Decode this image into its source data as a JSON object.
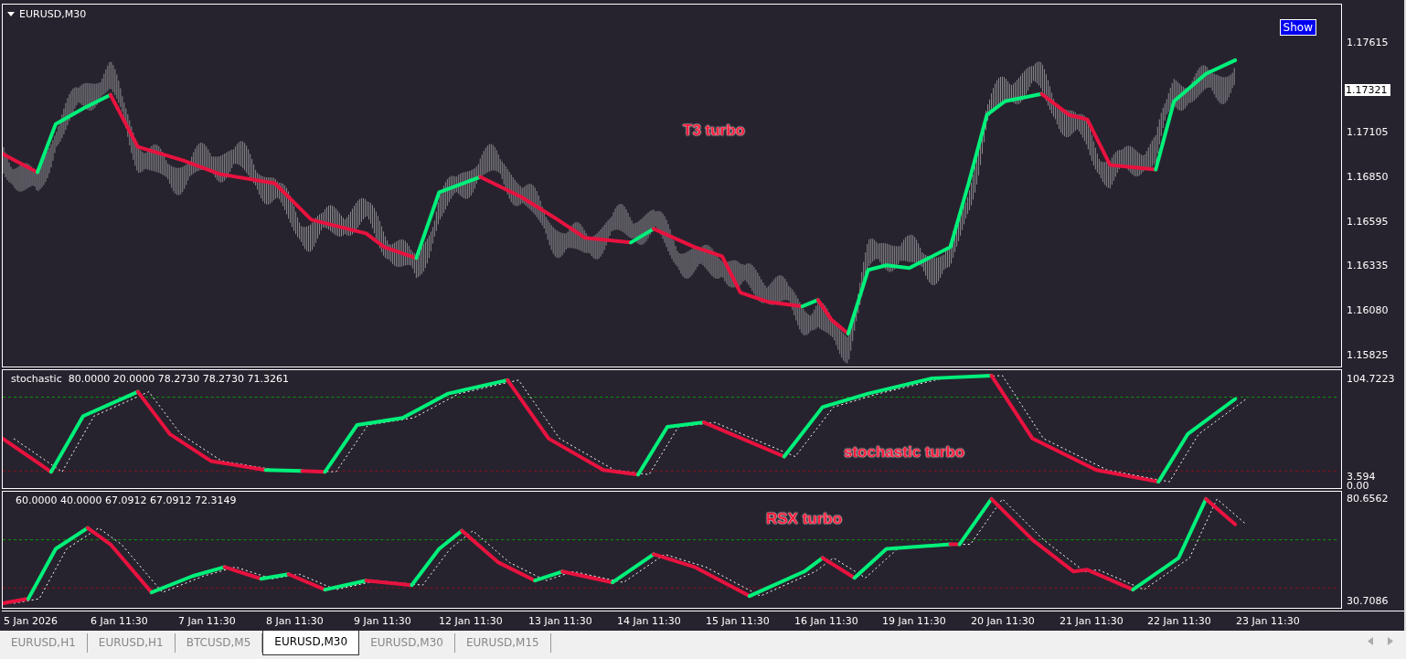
{
  "main_chart": {
    "title": "EURUSD,M30",
    "show_button": "Show",
    "indicator_label": "T3 turbo",
    "price_axis": [
      "1.17615",
      "1.17105",
      "1.16850",
      "1.16595",
      "1.16335",
      "1.16080",
      "1.15825"
    ],
    "current_price": "1.17321"
  },
  "stochastic_pane": {
    "header": "stochastic  80.0000 20.0000 78.2730 78.2730 71.3261",
    "indicator_label": "stochastic turbo",
    "axis": [
      "104.7223",
      "3.594",
      "0.00"
    ]
  },
  "rsx_pane": {
    "header": "60.0000 40.0000 67.0912 67.0912 72.3149",
    "indicator_label": "RSX turbo",
    "axis": [
      "80.6562",
      "30.7086"
    ]
  },
  "time_axis": [
    "5 Jan 2026",
    "6 Jan 11:30",
    "7 Jan 11:30",
    "8 Jan 11:30",
    "9 Jan 11:30",
    "12 Jan 11:30",
    "13 Jan 11:30",
    "14 Jan 11:30",
    "15 Jan 11:30",
    "16 Jan 11:30",
    "19 Jan 11:30",
    "20 Jan 11:30",
    "21 Jan 11:30",
    "22 Jan 11:30",
    "23 Jan 11:30"
  ],
  "tabs": [
    {
      "label": "EURUSD,H1",
      "selected": false
    },
    {
      "label": "EURUSD,H1",
      "selected": false
    },
    {
      "label": "BTCUSD,M5",
      "selected": false
    },
    {
      "label": "EURUSD,M30",
      "selected": true
    },
    {
      "label": "EURUSD,M30",
      "selected": false
    },
    {
      "label": "EURUSD,M15",
      "selected": false
    }
  ]
}
